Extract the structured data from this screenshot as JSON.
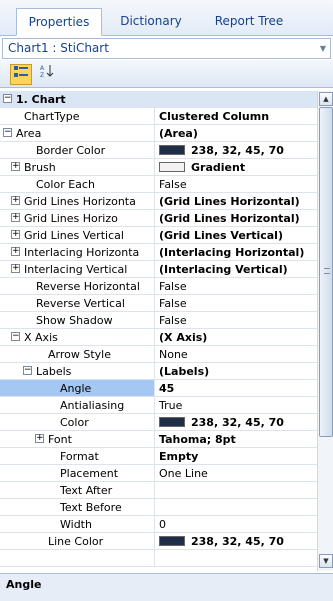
{
  "tabs": [
    "Properties",
    "Dictionary",
    "Report Tree"
  ],
  "object_selector": {
    "value": "Chart1 : StiChart"
  },
  "toolbar": {
    "categorized_icon": "categorized-icon",
    "alphabetical_icon": "sort-az-icon"
  },
  "grid": {
    "rows": [
      {
        "label": "1. Chart",
        "value": "",
        "indent": 0,
        "expander": "minus",
        "cat": true
      },
      {
        "label": "ChartType",
        "value": "Clustered Column",
        "indent": 1,
        "bold": true
      },
      {
        "label": "Area",
        "value": "(Area)",
        "indent": 0,
        "expander": "minus",
        "bold": true
      },
      {
        "label": "Border Color",
        "value": "238, 32, 45, 70",
        "indent": 2,
        "bold": true,
        "swatch": "#202d46"
      },
      {
        "label": "Brush",
        "value": "Gradient",
        "indent": 1,
        "expander": "plus",
        "bold": true,
        "swatch": "#f2f2f2"
      },
      {
        "label": "Color Each",
        "value": "False",
        "indent": 2
      },
      {
        "label": "Grid Lines Horizonta",
        "value": "(Grid Lines Horizontal)",
        "indent": 1,
        "expander": "plus",
        "bold": true
      },
      {
        "label": "Grid Lines Horizo",
        "value": "(Grid Lines Horizontal)",
        "indent": 1,
        "expander": "plus",
        "bold": true
      },
      {
        "label": "Grid Lines Vertical",
        "value": "(Grid Lines Vertical)",
        "indent": 1,
        "expander": "plus",
        "bold": true
      },
      {
        "label": "Interlacing Horizonta",
        "value": "(Interlacing Horizontal)",
        "indent": 1,
        "expander": "plus",
        "bold": true
      },
      {
        "label": "Interlacing Vertical",
        "value": "(Interlacing Vertical)",
        "indent": 1,
        "expander": "plus",
        "bold": true
      },
      {
        "label": "Reverse Horizontal",
        "value": "False",
        "indent": 2
      },
      {
        "label": "Reverse Vertical",
        "value": "False",
        "indent": 2
      },
      {
        "label": "Show Shadow",
        "value": "False",
        "indent": 2
      },
      {
        "label": "X Axis",
        "value": "(X Axis)",
        "indent": 1,
        "expander": "minus",
        "bold": true
      },
      {
        "label": "Arrow Style",
        "value": "None",
        "indent": 3
      },
      {
        "label": "Labels",
        "value": "(Labels)",
        "indent": 2,
        "expander": "minus",
        "bold": true
      },
      {
        "label": "Angle",
        "value": "45",
        "indent": 4,
        "bold": true,
        "selected": true
      },
      {
        "label": "Antialiasing",
        "value": "True",
        "indent": 4
      },
      {
        "label": "Color",
        "value": "238, 32, 45, 70",
        "indent": 4,
        "bold": true,
        "swatch": "#202d46"
      },
      {
        "label": "Font",
        "value": "Tahoma; 8pt",
        "indent": 3,
        "expander": "plus",
        "bold": true
      },
      {
        "label": "Format",
        "value": "Empty",
        "indent": 4,
        "bold": true
      },
      {
        "label": "Placement",
        "value": "One Line",
        "indent": 4
      },
      {
        "label": "Text After",
        "value": "",
        "indent": 4
      },
      {
        "label": "Text Before",
        "value": "",
        "indent": 4
      },
      {
        "label": "Width",
        "value": "0",
        "indent": 4
      },
      {
        "label": "Line Color",
        "value": "238, 32, 45, 70",
        "indent": 3,
        "bold": true,
        "swatch": "#202d46"
      },
      {
        "label": "",
        "value": "",
        "indent": 3
      }
    ]
  },
  "help_title": "Angle"
}
